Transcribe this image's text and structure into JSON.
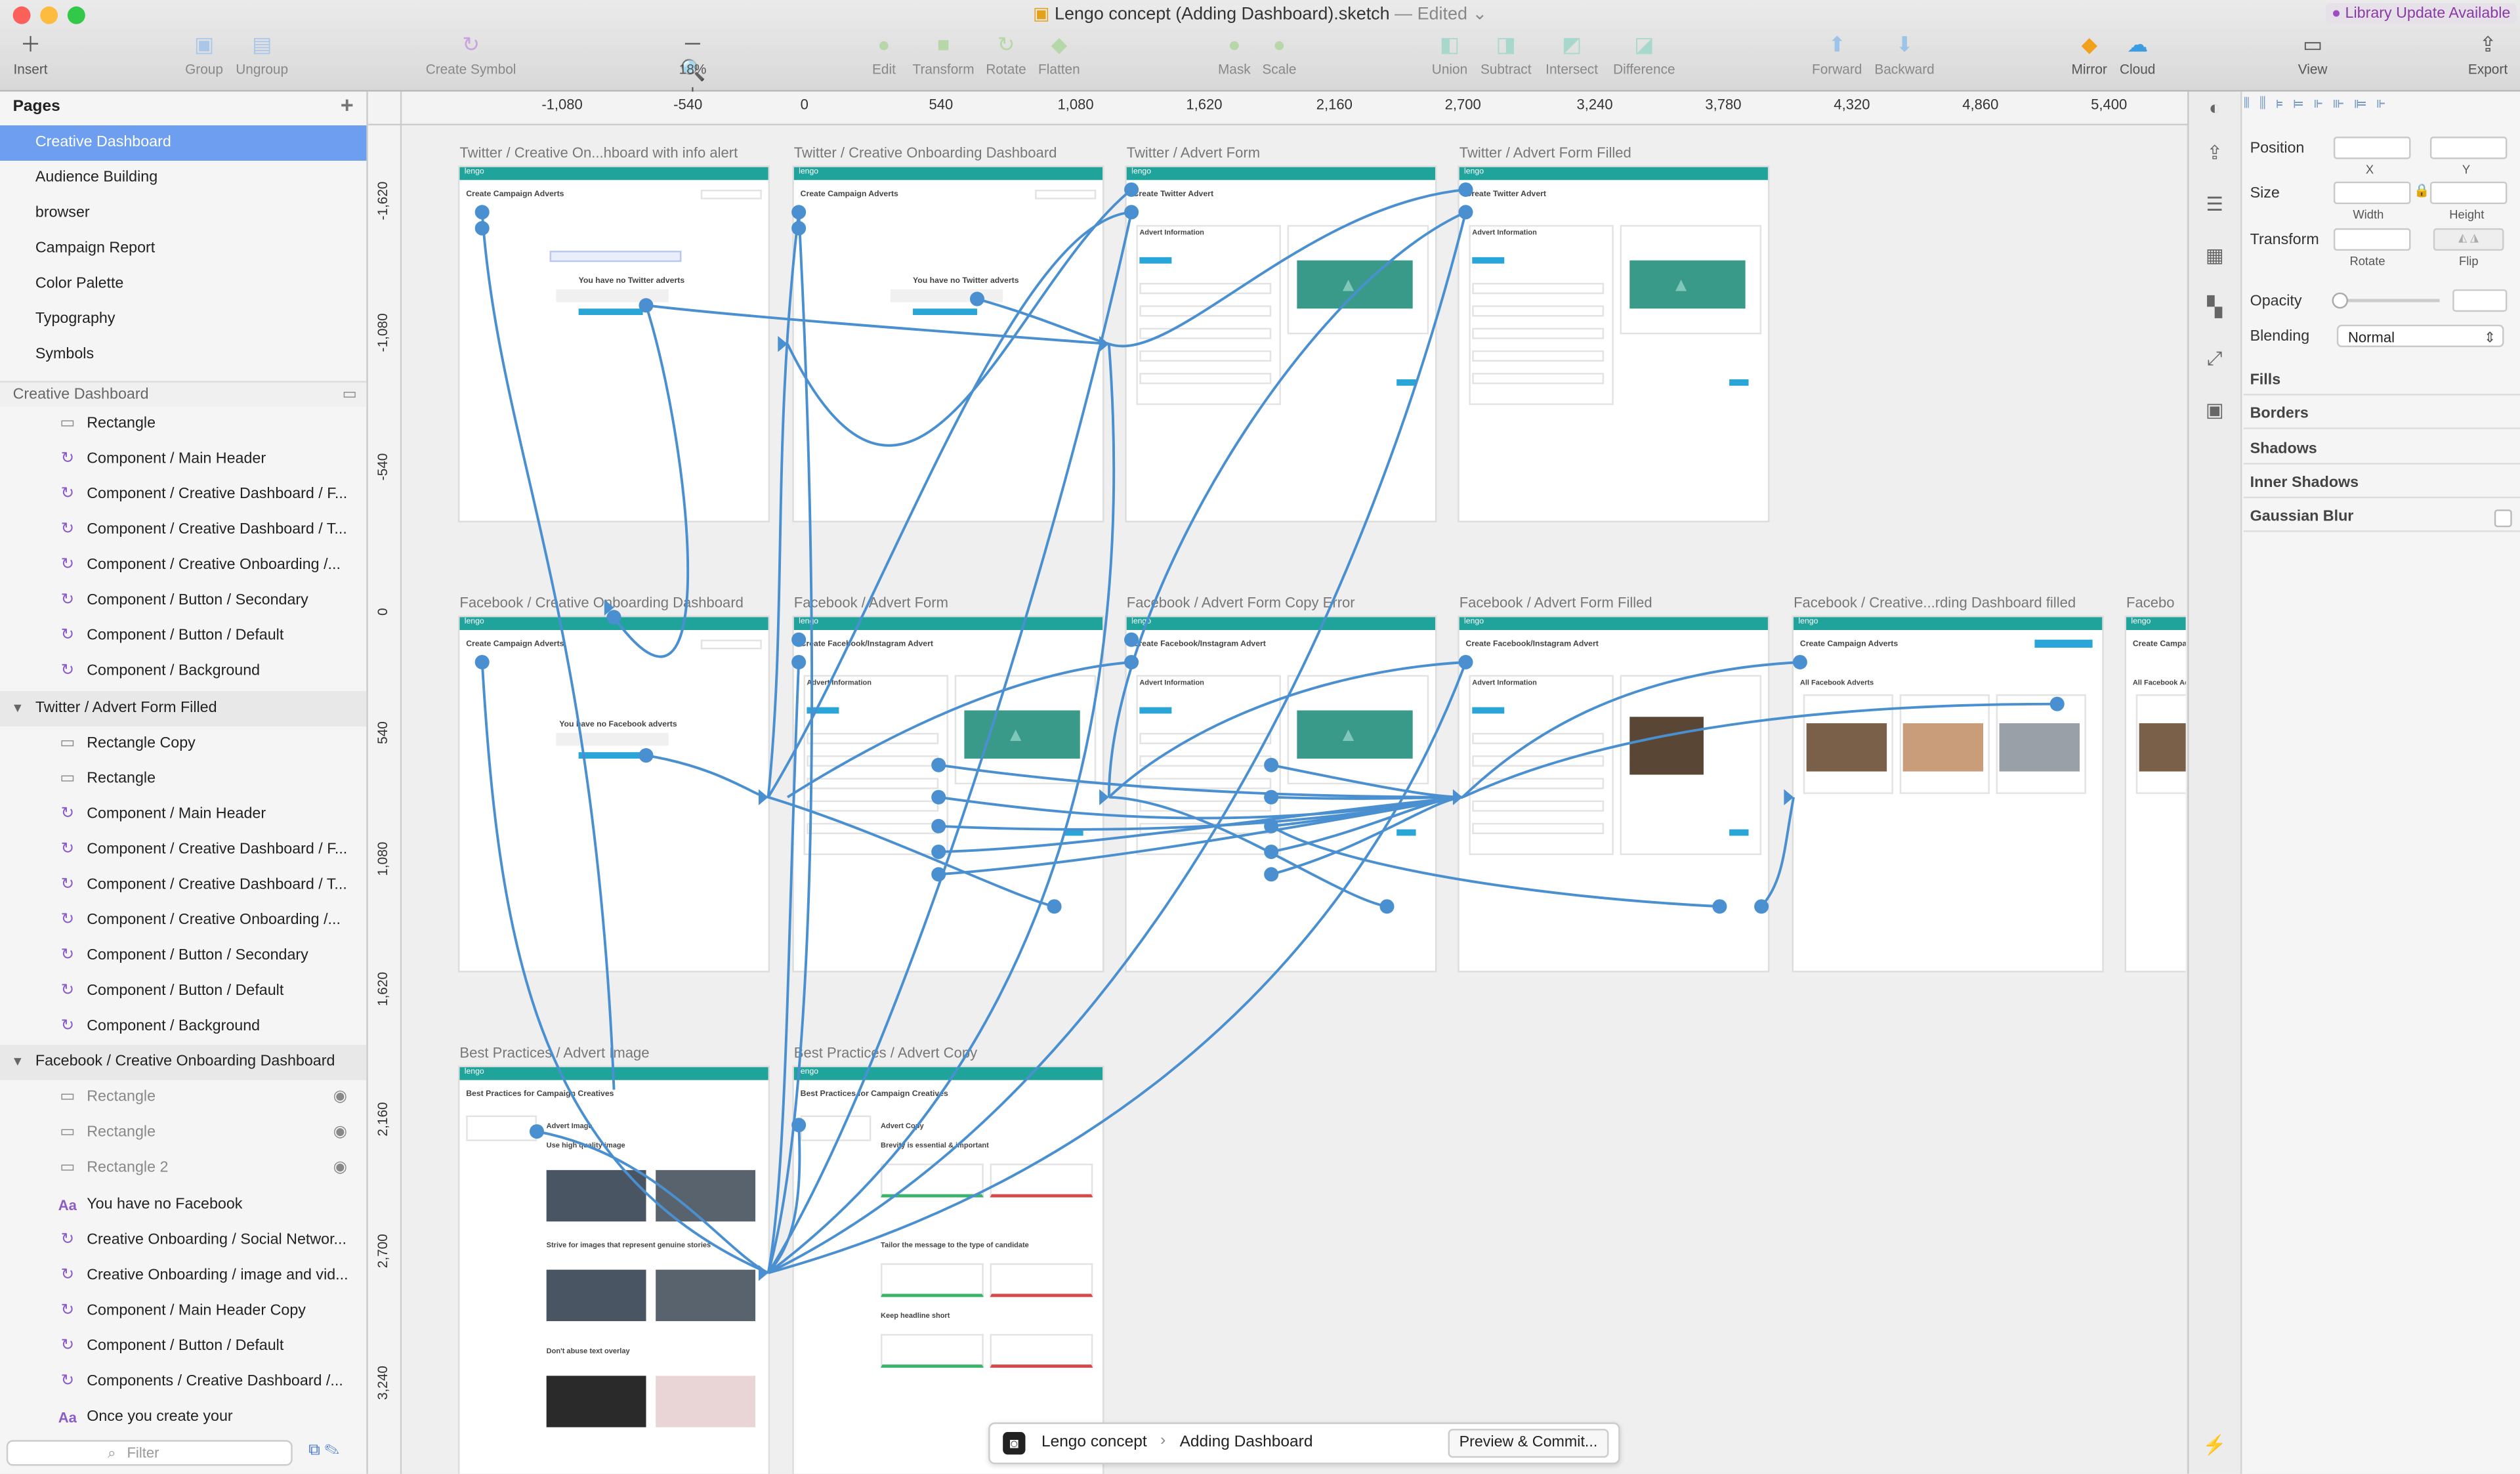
{
  "window": {
    "title": "Lengo concept (Adding Dashboard).sketch",
    "edited": "— Edited",
    "library_update": "Library Update Available"
  },
  "toolbar": {
    "insert": "Insert",
    "group": "Group",
    "ungroup": "Ungroup",
    "create_symbol": "Create Symbol",
    "zoom": "18%",
    "edit": "Edit",
    "transform": "Transform",
    "rotate": "Rotate",
    "flatten": "Flatten",
    "mask": "Mask",
    "scale": "Scale",
    "union": "Union",
    "subtract": "Subtract",
    "intersect": "Intersect",
    "difference": "Difference",
    "forward": "Forward",
    "backward": "Backward",
    "mirror": "Mirror",
    "cloud": "Cloud",
    "view": "View",
    "export": "Export"
  },
  "pages": {
    "header": "Pages",
    "items": [
      "Creative Dashboard",
      "Audience Building",
      "browser",
      "Campaign Report",
      "Color Palette",
      "Typography",
      "Symbols"
    ],
    "selected": "Creative Dashboard"
  },
  "layers_header": "Creative Dashboard",
  "layers": [
    {
      "label": "Rectangle",
      "kind": "rect"
    },
    {
      "label": "Component / Main Header",
      "kind": "symbol"
    },
    {
      "label": "Component / Creative Dashboard / F...",
      "kind": "symbol"
    },
    {
      "label": "Component / Creative Dashboard / T...",
      "kind": "symbol"
    },
    {
      "label": "Component / Creative Onboarding /...",
      "kind": "symbol"
    },
    {
      "label": "Component / Button / Secondary",
      "kind": "symbol"
    },
    {
      "label": "Component / Button / Default",
      "kind": "symbol"
    },
    {
      "label": "Component / Background",
      "kind": "symbol"
    },
    {
      "label": "Twitter / Advert Form Filled",
      "kind": "group"
    },
    {
      "label": "Rectangle Copy",
      "kind": "rect"
    },
    {
      "label": "Rectangle",
      "kind": "rect"
    },
    {
      "label": "Component / Main Header",
      "kind": "symbol"
    },
    {
      "label": "Component / Creative Dashboard / F...",
      "kind": "symbol"
    },
    {
      "label": "Component / Creative Dashboard / T...",
      "kind": "symbol"
    },
    {
      "label": "Component / Creative Onboarding /...",
      "kind": "symbol"
    },
    {
      "label": "Component / Button / Secondary",
      "kind": "symbol"
    },
    {
      "label": "Component / Button / Default",
      "kind": "symbol"
    },
    {
      "label": "Component / Background",
      "kind": "symbol"
    },
    {
      "label": "Facebook / Creative Onboarding Dashboard",
      "kind": "group"
    },
    {
      "label": "Rectangle",
      "kind": "rect",
      "hidden": true
    },
    {
      "label": "Rectangle",
      "kind": "rect",
      "hidden": true
    },
    {
      "label": "Rectangle 2",
      "kind": "rect",
      "hidden": true
    },
    {
      "label": "You have no Facebook",
      "kind": "text"
    },
    {
      "label": "Creative Onboarding / Social Networ...",
      "kind": "symbol"
    },
    {
      "label": "Creative Onboarding / image and vid...",
      "kind": "symbol"
    },
    {
      "label": "Component / Main Header Copy",
      "kind": "symbol"
    },
    {
      "label": "Component / Button / Default",
      "kind": "symbol"
    },
    {
      "label": "Components / Creative Dashboard /...",
      "kind": "symbol"
    },
    {
      "label": "Once you create your",
      "kind": "text"
    }
  ],
  "filter_placeholder": "Filter",
  "ruler_h": [
    "-1,080",
    "-540",
    "0",
    "540",
    "1,080",
    "1,620",
    "2,160",
    "2,700",
    "3,240",
    "3,780",
    "4,320",
    "4,860",
    "5,400"
  ],
  "ruler_v": [
    "-1,620",
    "-1,080",
    "-540",
    "0",
    "540",
    "1,080",
    "1,620",
    "2,160",
    "2,700",
    "3,240"
  ],
  "artboards": [
    {
      "label": "Twitter / Creative On...hboard with info alert",
      "heading": "Create Campaign Adverts",
      "body": "You have no Twitter adverts"
    },
    {
      "label": "Twitter / Creative Onboarding Dashboard",
      "heading": "Create Campaign Adverts",
      "body": "You have no Twitter adverts"
    },
    {
      "label": "Twitter / Advert Form",
      "heading": "Create Twitter Advert",
      "body": "Advert Information"
    },
    {
      "label": "Twitter / Advert Form Filled",
      "heading": "Create Twitter Advert",
      "body": "Advert Information"
    },
    {
      "label": "Facebook / Creative Onboarding Dashboard",
      "heading": "Create Campaign Adverts",
      "body": "You have no Facebook adverts"
    },
    {
      "label": "Facebook / Advert Form",
      "heading": "Create Facebook/Instagram Advert",
      "body": "Advert Information"
    },
    {
      "label": "Facebook / Advert Form Copy Error",
      "heading": "Create Facebook/Instagram Advert",
      "body": "Advert Information"
    },
    {
      "label": "Facebook / Advert Form Filled",
      "heading": "Create Facebook/Instagram Advert",
      "body": "Advert Information"
    },
    {
      "label": "Facebook / Creative...rding Dashboard filled",
      "heading": "Create Campaign Adverts",
      "body": "All Facebook Adverts"
    },
    {
      "label": "Facebo",
      "heading": "Create Campaign Adverts",
      "body": "All Facebook Adverts"
    },
    {
      "label": "Best Practices / Advert Image",
      "heading": "Best Practices for Campaign Creatives",
      "body": "Advert Image"
    },
    {
      "label": "Best Practices / Advert Copy",
      "heading": "Best Practices for Campaign Creatives",
      "body": "Advert Copy"
    }
  ],
  "bestpractice": {
    "img_tips": [
      "Use high quality image",
      "Strive for images that represent genuine stories",
      "Don't abuse text overlay"
    ],
    "copy_tips": [
      "Brevity is essential & important",
      "Tailor the message to the type of candidate",
      "Keep headline short"
    ]
  },
  "breadcrumb": {
    "project": "Lengo concept",
    "page": "Adding Dashboard",
    "button": "Preview & Commit..."
  },
  "inspector": {
    "position": "Position",
    "x": "X",
    "y": "Y",
    "size": "Size",
    "width": "Width",
    "height": "Height",
    "transform": "Transform",
    "rotate": "Rotate",
    "flip": "Flip",
    "opacity": "Opacity",
    "blending": "Blending",
    "blend_value": "Normal",
    "sections": [
      "Fills",
      "Borders",
      "Shadows",
      "Inner Shadows",
      "Gaussian Blur"
    ]
  },
  "colors": {
    "accent": "#1fa39a",
    "flow": "#4a90d0",
    "selection": "#6d9ef0"
  }
}
